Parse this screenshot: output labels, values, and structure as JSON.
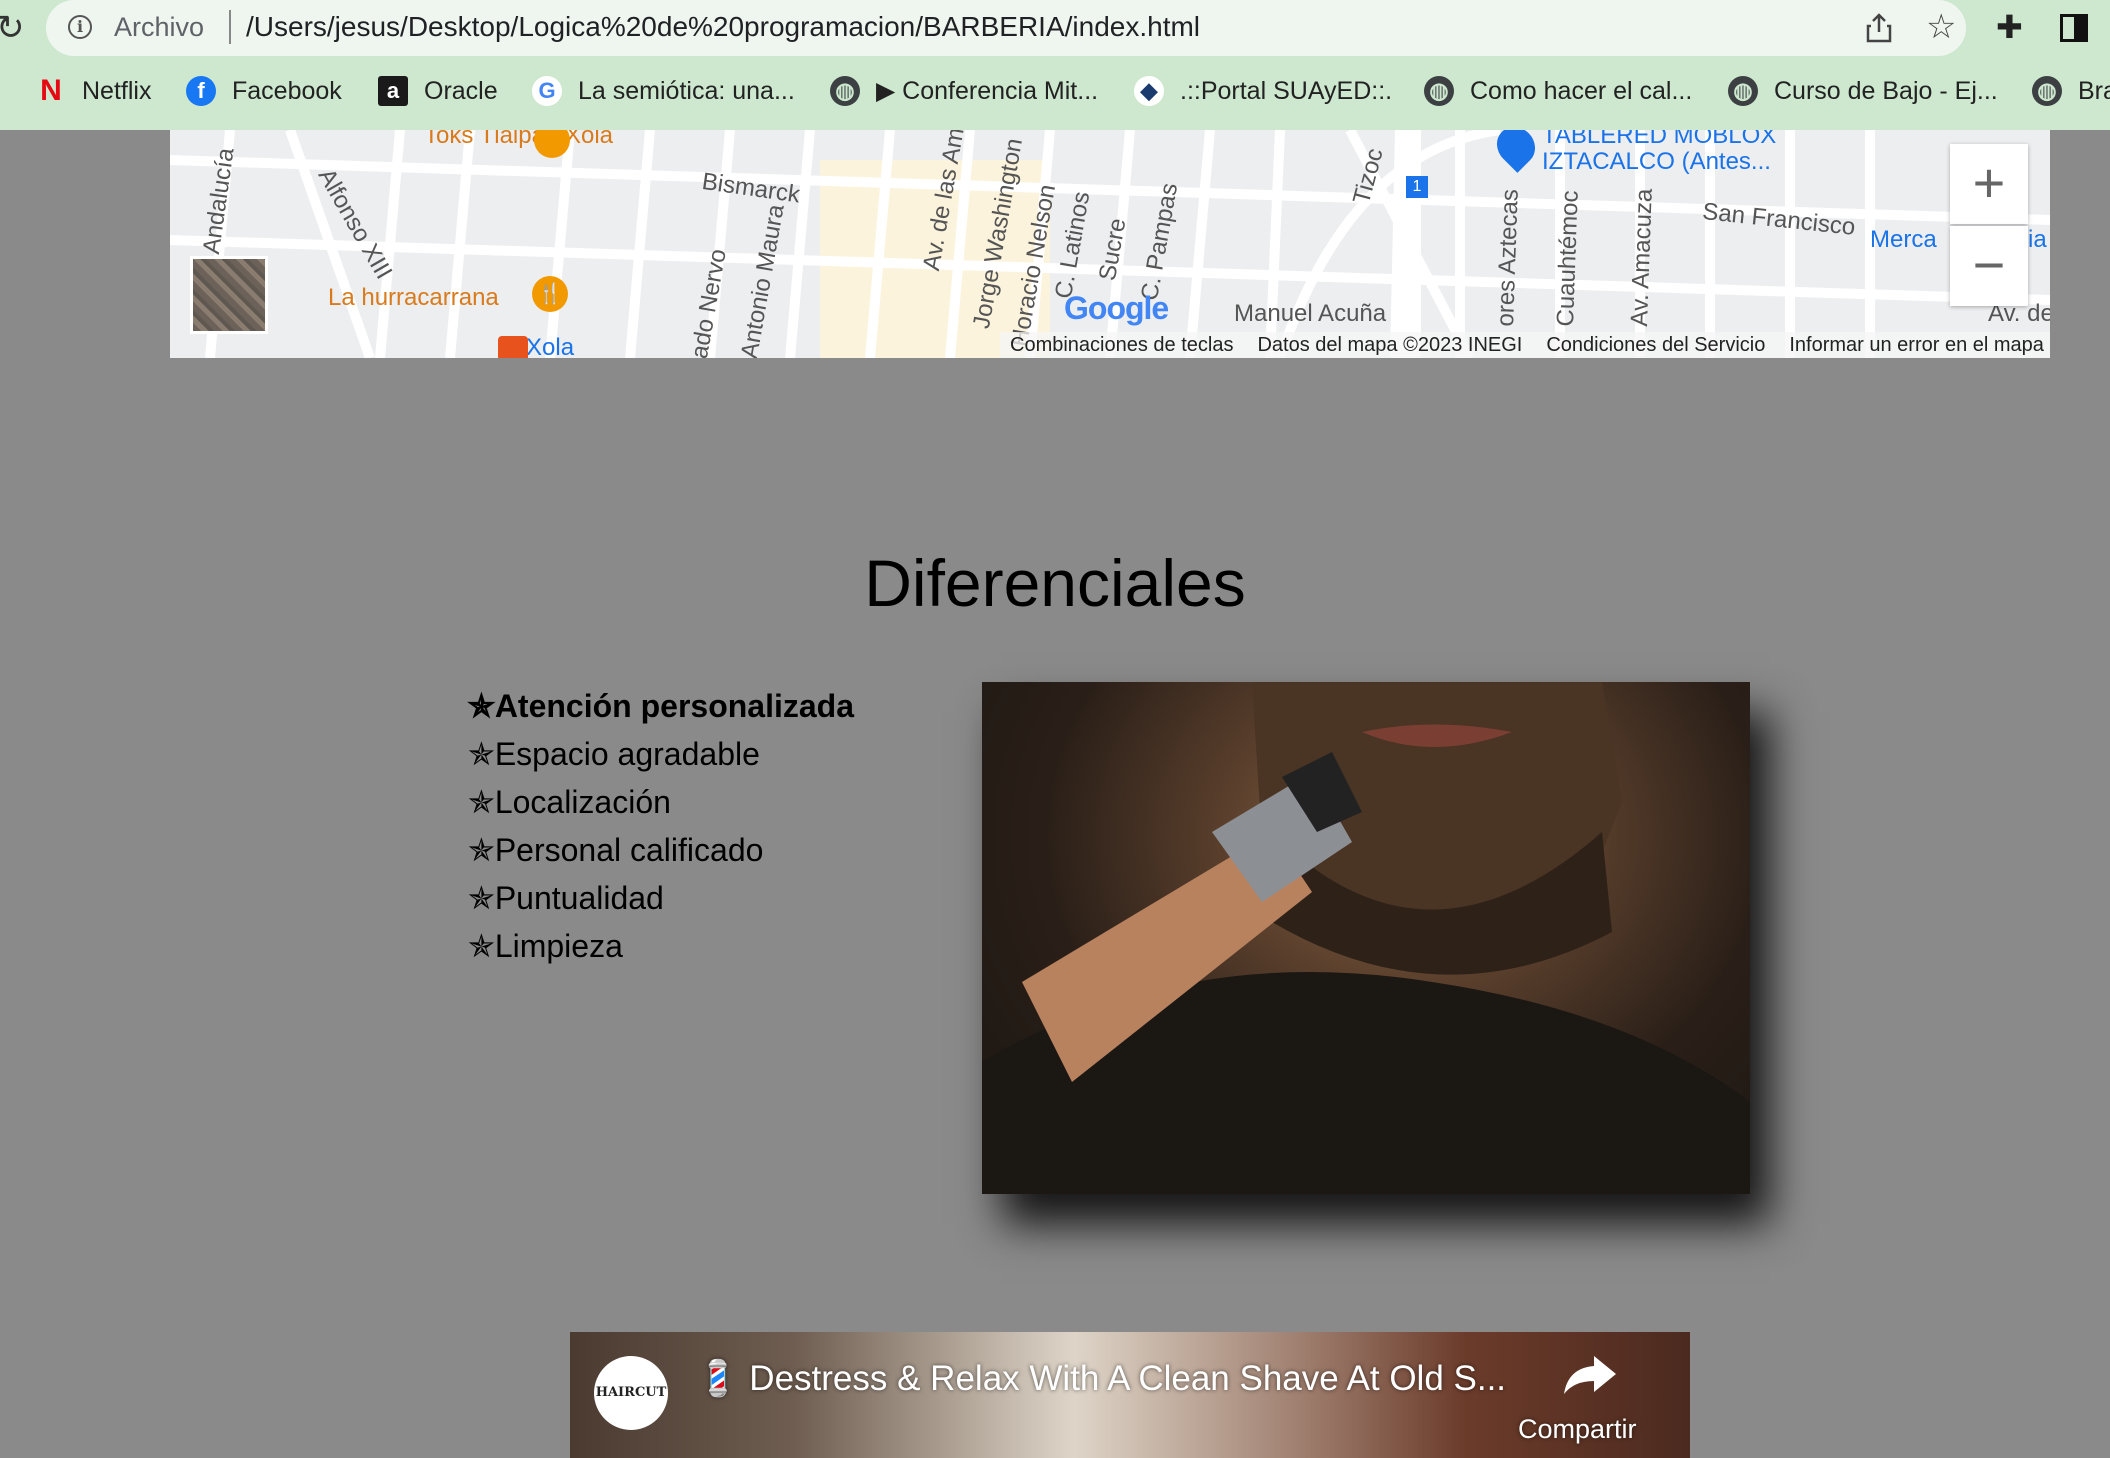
{
  "browser": {
    "scheme_label": "Archivo",
    "url": "/Users/jesus/Desktop/Logica%20de%20programacion/BARBERIA/index.html",
    "bookmarks": [
      {
        "label": "Netflix",
        "icon": "netflix-icon"
      },
      {
        "label": "Facebook",
        "icon": "facebook-icon"
      },
      {
        "label": "Oracle",
        "icon": "oracle-icon"
      },
      {
        "label": "La semiótica: una...",
        "icon": "google-icon"
      },
      {
        "label": "▶ Conferencia Mit...",
        "icon": "globe-icon"
      },
      {
        "label": ".::Portal SUAyED::.",
        "icon": "suayed-icon"
      },
      {
        "label": "Como hacer el cal...",
        "icon": "globe-icon"
      },
      {
        "label": "Curso de Bajo - Ej...",
        "icon": "globe-icon"
      },
      {
        "label": "Bra",
        "icon": "globe-icon"
      }
    ]
  },
  "map": {
    "labels": [
      "Toks Tlalpan Xola",
      "Bismarck",
      "Andalucía",
      "Alfonso XIII",
      "La hurracarrana",
      "Xola",
      "ado Nervo",
      "Antonio Maura",
      "Av. de las Am",
      "Jorge Washington",
      "Horacio Nelson",
      "C. Latinos",
      "Sucre",
      "C. Pampas",
      "Tizoc",
      "Manuel Acuña",
      "TABLERED MOBLOX",
      "IZTACALCO (Antes...",
      "San Francisco",
      "Merca",
      "ia",
      "ores Aztecas",
      "Cuauhtémoc",
      "Av. Amacuza",
      "Av. de",
      "1",
      "Google"
    ],
    "zoom_in_label": "+",
    "zoom_out_label": "−",
    "footer": [
      "Combinaciones de teclas",
      "Datos del mapa ©2023 INEGI",
      "Condiciones del Servicio",
      "Informar un error en el mapa"
    ]
  },
  "section": {
    "title": "Diferenciales",
    "features": [
      "✯Atención personalizada",
      "✯Espacio agradable",
      "✯Localización",
      "✯Personal calificado",
      "✯Puntualidad",
      "✯Limpieza"
    ]
  },
  "video": {
    "channel_avatar_text": "HAIRCUT HARRY",
    "title": "💈 Destress & Relax With A Clean Shave At Old S...",
    "share_label": "Compartir"
  }
}
